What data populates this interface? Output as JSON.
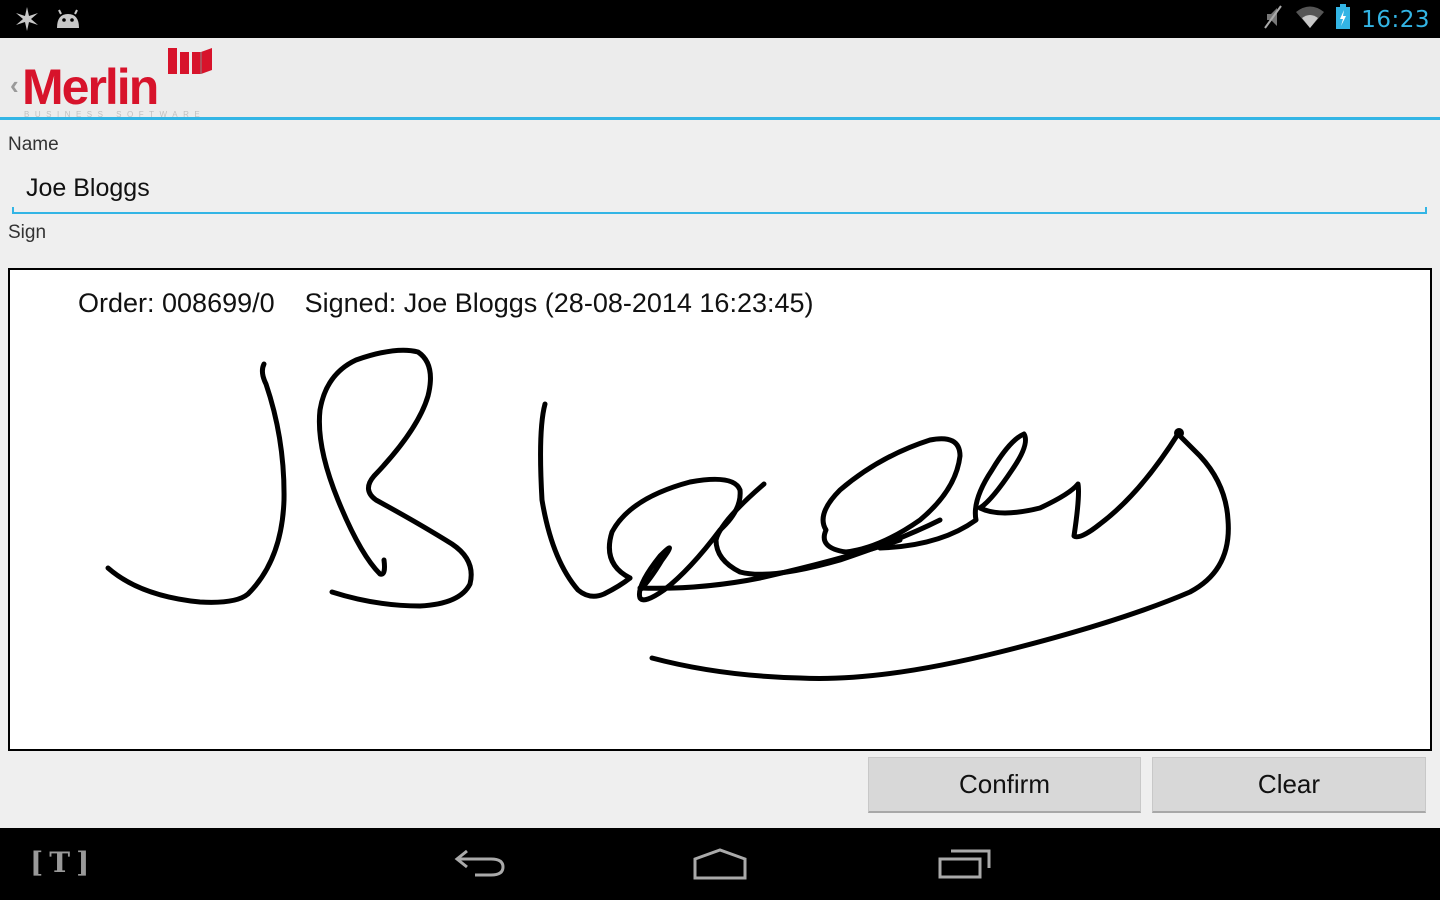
{
  "status_bar": {
    "left_icons": [
      "sparkle-notification-icon",
      "android-debug-icon"
    ],
    "right_icons": [
      "mute-icon",
      "wifi-icon",
      "battery-charging-icon"
    ],
    "time": "16:23",
    "accent_color": "#33b5e5"
  },
  "action_bar": {
    "back_icon": "back-chevron-icon",
    "logo_text": "Merlin",
    "logo_subtext": "BUSINESS SOFTWARE",
    "brand_color": "#d7132b"
  },
  "form": {
    "name_label": "Name",
    "name_value": "Joe Bloggs",
    "sign_label": "Sign"
  },
  "signature_pad": {
    "caption": "Order: 008699/0    Signed: Joe Bloggs (28-08-2014 16:23:45)",
    "order": "008699/0",
    "signed_by": "Joe Bloggs",
    "signed_at": "28-08-2014 16:23:45"
  },
  "buttons": {
    "confirm_label": "Confirm",
    "clear_label": "Clear"
  },
  "nav_bar": {
    "icons": [
      "t-app-icon",
      "back-icon",
      "home-icon",
      "recent-apps-icon"
    ],
    "t_glyph": "[T]"
  }
}
